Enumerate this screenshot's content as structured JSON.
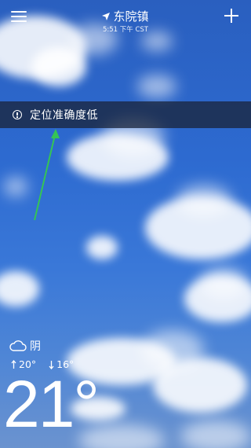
{
  "header": {
    "location": "东院镇",
    "time": "5:51 下午 CST"
  },
  "banner": {
    "text": "定位准确度低"
  },
  "weather": {
    "condition": "阴",
    "high": "20°",
    "low": "16°",
    "current_temp": "21°"
  },
  "icons": [
    "menu-icon",
    "add-icon",
    "location-arrow-icon",
    "warning-icon",
    "cloud-icon",
    "high-temp-icon",
    "low-temp-icon"
  ]
}
